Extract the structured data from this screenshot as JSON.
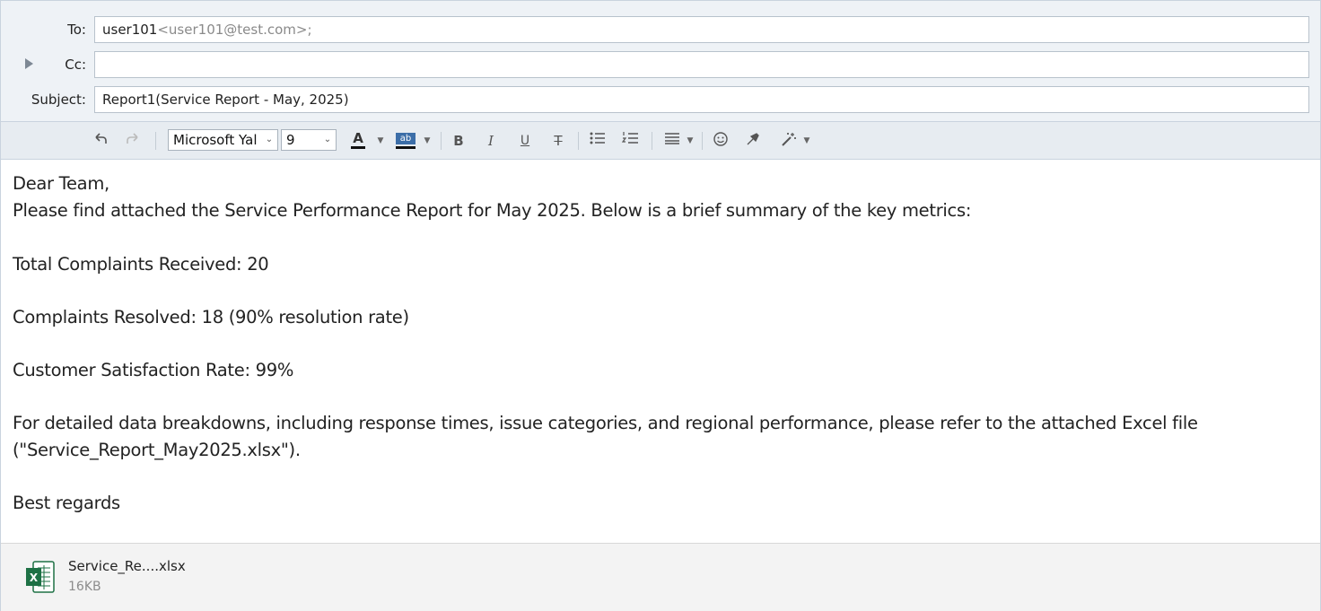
{
  "header": {
    "to_label": "To:",
    "to_name": "user101",
    "to_address": "<user101@test.com>;",
    "cc_label": "Cc:",
    "cc_value": "",
    "subject_label": "Subject:",
    "subject_value": "Report1(Service Report - May, 2025)"
  },
  "toolbar": {
    "font_family": "Microsoft Yal",
    "font_size": "9",
    "bold": "B",
    "italic": "I",
    "underline": "U",
    "strike": "T",
    "font_color_glyph": "A",
    "highlight_glyph": "ab"
  },
  "body": {
    "lines": [
      "Dear Team,",
      "Please find attached the Service Performance Report for May 2025. Below is a brief summary of the key metrics:",
      "Total Complaints Received: 20",
      "Complaints Resolved: 18 (90% resolution rate)",
      "Customer Satisfaction Rate: 99%",
      "For detailed data breakdowns, including response times, issue categories, and regional performance, please refer to the attached Excel file",
      "(\"Service_Report_May2025.xlsx\").",
      "Best regards"
    ]
  },
  "attachment": {
    "name": "Service_Re....xlsx",
    "size": "16KB",
    "icon_letter": "X"
  },
  "colors": {
    "header_bg": "#eef2f6",
    "toolbar_bg": "#e7ecf1",
    "excel_green": "#1e7145"
  }
}
